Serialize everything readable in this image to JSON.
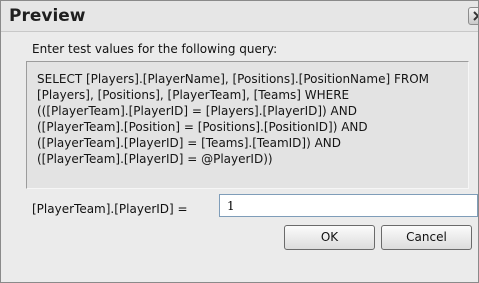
{
  "window": {
    "title": "Preview"
  },
  "dialog": {
    "prompt": "Enter test values for the following query:",
    "query_lines": [
      "SELECT [Players].[PlayerName], [Positions].[PositionName] FROM",
      "[Players], [Positions], [PlayerTeam], [Teams] WHERE",
      "(([PlayerTeam].[PlayerID] = [Players].[PlayerID]) AND",
      "([PlayerTeam].[Position] = [Positions].[PositionID]) AND",
      "([PlayerTeam].[PlayerID] = [Teams].[TeamID]) AND",
      "([PlayerTeam].[PlayerID] = @PlayerID))"
    ],
    "parameter": {
      "label": "[PlayerTeam].[PlayerID] =",
      "value": "1"
    },
    "buttons": {
      "ok": "OK",
      "cancel": "Cancel"
    }
  },
  "icons": {
    "close": "close-icon"
  }
}
